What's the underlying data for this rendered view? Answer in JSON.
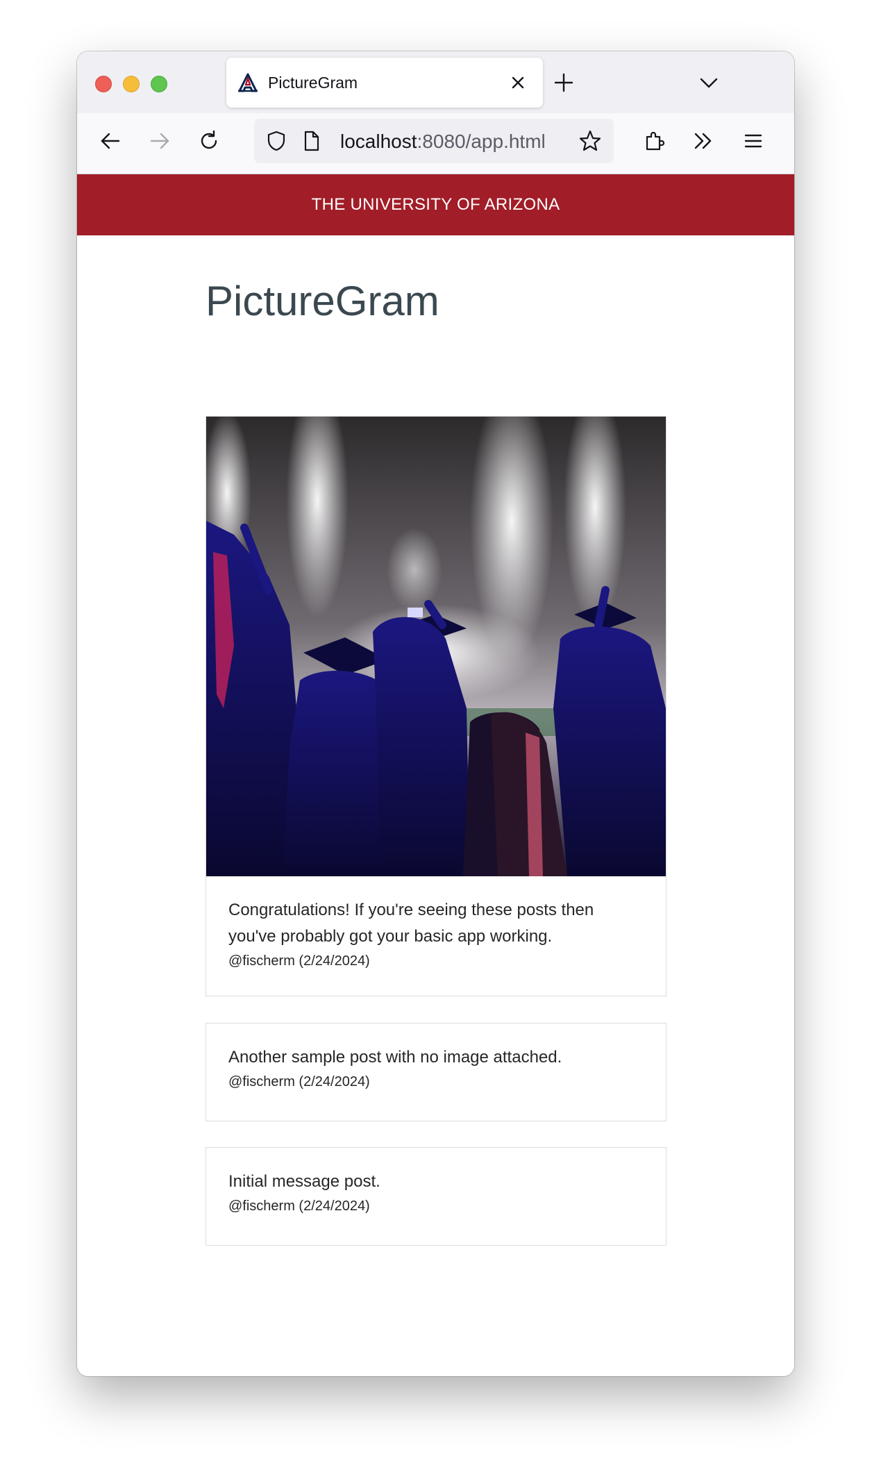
{
  "browser": {
    "tab": {
      "title": "PictureGram"
    },
    "url": {
      "host": "localhost",
      "rest": ":8080/app.html"
    }
  },
  "page": {
    "banner": "THE UNIVERSITY OF ARIZONA",
    "title": "PictureGram",
    "posts": [
      {
        "text": "Congratulations! If you're seeing these posts then you've probably got your basic app working.",
        "meta": "@fischerm (2/24/2024)",
        "has_image": true
      },
      {
        "text": "Another sample post with no image attached.",
        "meta": "@fischerm (2/24/2024)",
        "has_image": false
      },
      {
        "text": "Initial message post.",
        "meta": "@fischerm (2/24/2024)",
        "has_image": false
      }
    ]
  },
  "colors": {
    "banner": "#a11d28",
    "title": "#3b4850"
  }
}
